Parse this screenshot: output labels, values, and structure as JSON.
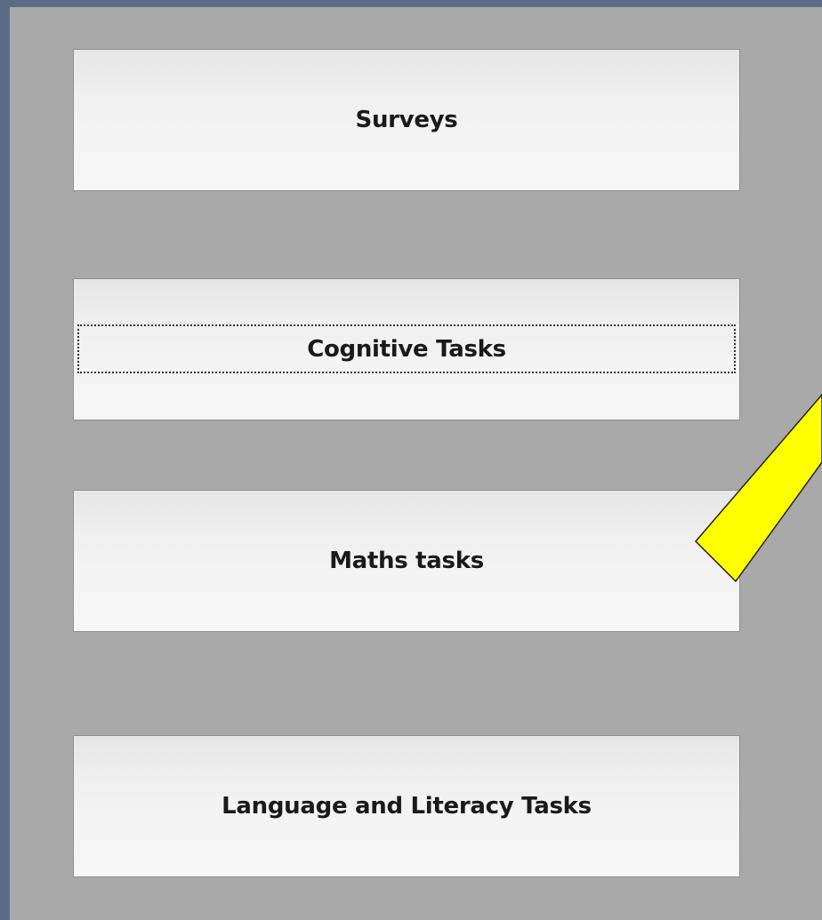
{
  "menu": {
    "surveys_label": "Surveys",
    "cognitive_label": "Cognitive Tasks",
    "maths_label": "Maths tasks",
    "language_label": "Language and Literacy Tasks"
  },
  "focused_item": "Cognitive Tasks",
  "colors": {
    "background_frame": "#5b6d86",
    "panel": "#a9a9a9",
    "button_face": "#f2f2f2",
    "annotation_arrow_fill": "#ffff00",
    "annotation_arrow_stroke": "#222222"
  }
}
